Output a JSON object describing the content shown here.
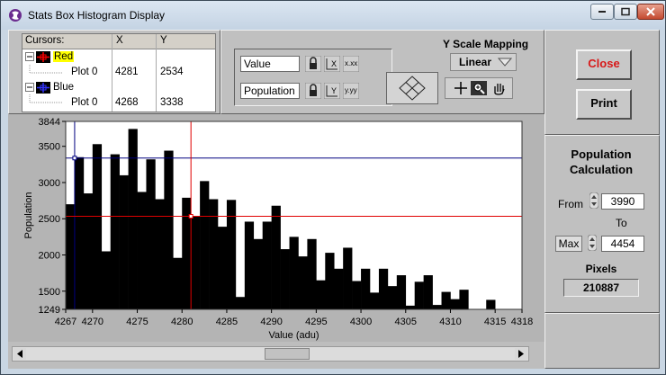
{
  "window": {
    "title": "Stats Box Histogram Display"
  },
  "cursors_table": {
    "headers": [
      "Cursors:",
      "X",
      "Y"
    ],
    "rows": [
      {
        "label": "Red",
        "color": "#ff0000",
        "indent": 0,
        "x": "",
        "y": ""
      },
      {
        "label": "Plot 0",
        "indent": 1,
        "x": "4281",
        "y": "2534"
      },
      {
        "label": "Blue",
        "color": "#0000cc",
        "indent": 0,
        "x": "",
        "y": ""
      },
      {
        "label": "Plot 0",
        "indent": 1,
        "x": "4268",
        "y": "3338"
      }
    ]
  },
  "scale_controls": {
    "x_name": "Value",
    "y_name": "Population",
    "y_scale_label": "Y Scale Mapping",
    "y_scale_value": "Linear"
  },
  "buttons": {
    "close": "Close",
    "print": "Print"
  },
  "population_calc": {
    "title": "Population Calculation",
    "from_label": "From",
    "from_value": "3990",
    "to_label": "To",
    "max_label": "Max",
    "to_value": "4454",
    "pixels_label": "Pixels",
    "pixels_value": "210887"
  },
  "chart_data": {
    "type": "bar",
    "xlabel": "Value (adu)",
    "ylabel": "Population",
    "xlim": [
      4267,
      4318
    ],
    "ylim": [
      1249,
      3844
    ],
    "x_ticks": [
      "4267",
      "4270",
      "4275",
      "4280",
      "4285",
      "4290",
      "4295",
      "4300",
      "4305",
      "4310",
      "4315",
      "4318"
    ],
    "y_ticks": [
      "1249",
      "1500",
      "2000",
      "2500",
      "3000",
      "3500",
      "3844"
    ],
    "bars": [
      {
        "x": 4267,
        "y": 2700
      },
      {
        "x": 4268,
        "y": 3350
      },
      {
        "x": 4269,
        "y": 2850
      },
      {
        "x": 4270,
        "y": 3530
      },
      {
        "x": 4271,
        "y": 2050
      },
      {
        "x": 4272,
        "y": 3390
      },
      {
        "x": 4273,
        "y": 3100
      },
      {
        "x": 4274,
        "y": 3740
      },
      {
        "x": 4275,
        "y": 2870
      },
      {
        "x": 4276,
        "y": 3320
      },
      {
        "x": 4277,
        "y": 2770
      },
      {
        "x": 4278,
        "y": 3440
      },
      {
        "x": 4279,
        "y": 1960
      },
      {
        "x": 4280,
        "y": 2790
      },
      {
        "x": 4281,
        "y": 2540
      },
      {
        "x": 4282,
        "y": 3020
      },
      {
        "x": 4283,
        "y": 2770
      },
      {
        "x": 4284,
        "y": 2390
      },
      {
        "x": 4285,
        "y": 2760
      },
      {
        "x": 4286,
        "y": 1420
      },
      {
        "x": 4287,
        "y": 2460
      },
      {
        "x": 4288,
        "y": 2220
      },
      {
        "x": 4289,
        "y": 2460
      },
      {
        "x": 4290,
        "y": 2680
      },
      {
        "x": 4291,
        "y": 2080
      },
      {
        "x": 4292,
        "y": 2250
      },
      {
        "x": 4293,
        "y": 1980
      },
      {
        "x": 4294,
        "y": 2220
      },
      {
        "x": 4295,
        "y": 1650
      },
      {
        "x": 4296,
        "y": 2030
      },
      {
        "x": 4297,
        "y": 1810
      },
      {
        "x": 4298,
        "y": 2100
      },
      {
        "x": 4299,
        "y": 1640
      },
      {
        "x": 4300,
        "y": 1810
      },
      {
        "x": 4301,
        "y": 1480
      },
      {
        "x": 4302,
        "y": 1810
      },
      {
        "x": 4303,
        "y": 1570
      },
      {
        "x": 4304,
        "y": 1720
      },
      {
        "x": 4305,
        "y": 1300
      },
      {
        "x": 4306,
        "y": 1630
      },
      {
        "x": 4307,
        "y": 1720
      },
      {
        "x": 4308,
        "y": 1310
      },
      {
        "x": 4309,
        "y": 1490
      },
      {
        "x": 4310,
        "y": 1390
      },
      {
        "x": 4311,
        "y": 1520
      },
      {
        "x": 4314,
        "y": 1380
      }
    ],
    "red_cursor": {
      "x": 4281,
      "y": 2534,
      "color": "#ff0000"
    },
    "blue_cursor": {
      "x": 4268,
      "y": 3338,
      "color": "#000080"
    }
  }
}
